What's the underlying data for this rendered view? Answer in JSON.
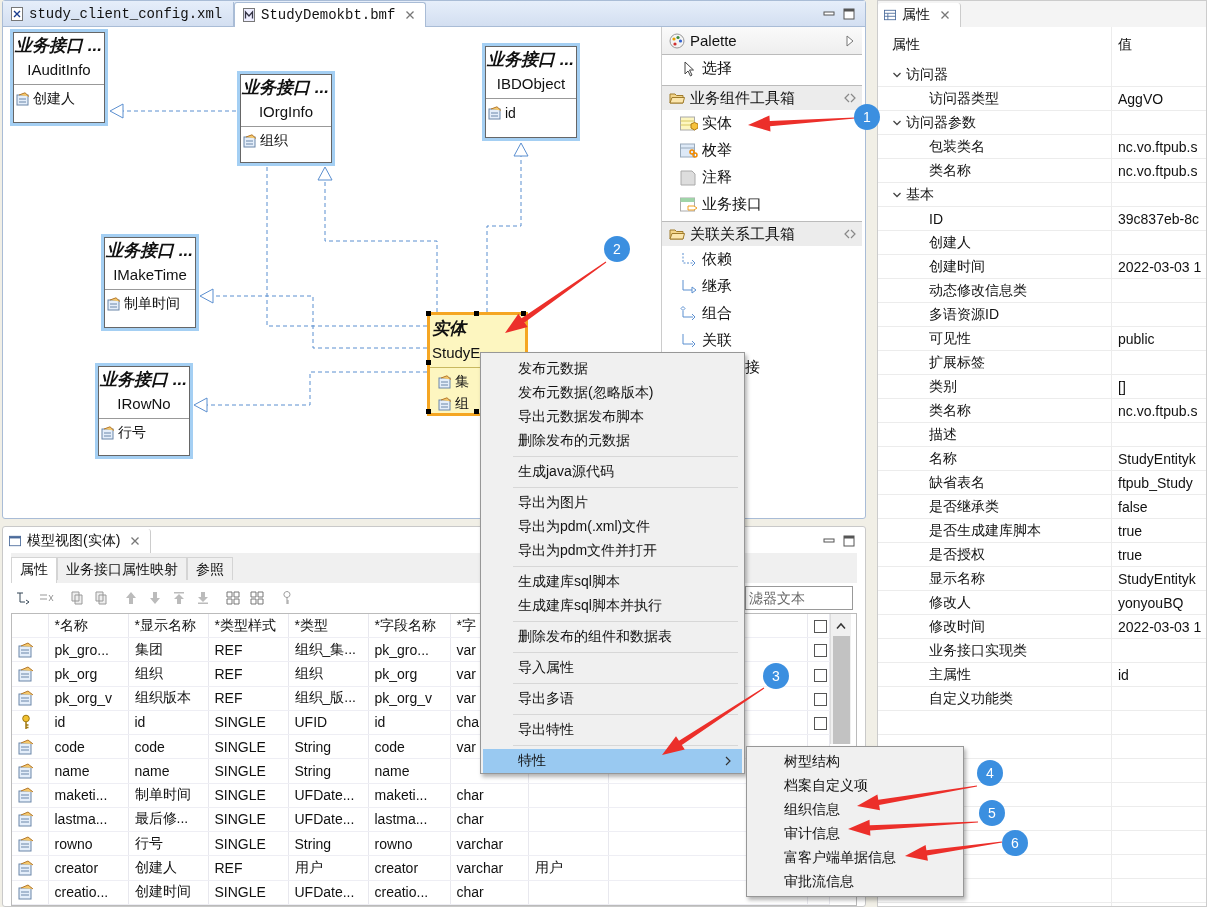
{
  "editor": {
    "tabs": [
      {
        "label": "study_client_config.xml",
        "kind": "xml",
        "selected": false,
        "closable": false
      },
      {
        "label": "StudyDemokbt.bmf",
        "kind": "bmf",
        "selected": true,
        "closable": true
      }
    ],
    "nodes": [
      {
        "kind": "interface",
        "stereotype": "业务接口 ...",
        "name": "IAuditInfo",
        "attributes": [
          "创建人"
        ],
        "selected": false
      },
      {
        "kind": "interface",
        "stereotype": "业务接口 ...",
        "name": "IOrgInfo",
        "attributes": [
          "组织"
        ],
        "selected": false
      },
      {
        "kind": "interface",
        "stereotype": "业务接口 ...",
        "name": "IBDObject",
        "attributes": [
          "id"
        ],
        "selected": false
      },
      {
        "kind": "interface",
        "stereotype": "业务接口 ...",
        "name": "IMakeTime",
        "attributes": [
          "制单时间"
        ],
        "selected": false
      },
      {
        "kind": "interface",
        "stereotype": "业务接口 ...",
        "name": "IRowNo",
        "attributes": [
          "行号"
        ],
        "selected": false
      },
      {
        "kind": "entity",
        "stereotype": "实体",
        "name": "StudyE",
        "attributes": [
          "集",
          "组"
        ],
        "selected": true
      }
    ],
    "connectors": [
      {
        "kind": "realization"
      },
      {
        "kind": "realization"
      },
      {
        "kind": "realization"
      },
      {
        "kind": "realization"
      },
      {
        "kind": "realization"
      }
    ],
    "palette": {
      "title": "Palette",
      "tools": [
        {
          "label": "选择",
          "kind": "select"
        }
      ],
      "drawers": [
        {
          "label": "业务组件工具箱",
          "expanded": true,
          "items": [
            {
              "label": "实体",
              "kind": "entity"
            },
            {
              "label": "枚举",
              "kind": "enum"
            },
            {
              "label": "注释",
              "kind": "note"
            },
            {
              "label": "业务接口",
              "kind": "interface"
            }
          ]
        },
        {
          "label": "关联关系工具箱",
          "expanded": true,
          "items": [
            {
              "label": "依赖",
              "kind": "dependency"
            },
            {
              "label": "继承",
              "kind": "inherit"
            },
            {
              "label": "组合",
              "kind": "compose"
            },
            {
              "label": "关联",
              "kind": "associate"
            },
            {
              "label": "接",
              "kind": "covered"
            }
          ]
        }
      ]
    }
  },
  "model_view": {
    "title": "模型视图(实体)",
    "tabs": [
      {
        "label": "属性",
        "selected": true
      },
      {
        "label": "业务接口属性映射",
        "selected": false
      },
      {
        "label": "参照",
        "selected": false
      }
    ],
    "filter": {
      "placeholder": "滤器文本"
    },
    "all_checked": false,
    "columns": [
      "*名称",
      "*显示名称",
      "*类型样式",
      "*类型",
      "*字段名称",
      "*字"
    ],
    "rows": [
      {
        "kind": "attribute",
        "cells": [
          "pk_gro...",
          "集团",
          "REF",
          "组织_集...",
          "pk_gro...",
          "var"
        ],
        "checked": false
      },
      {
        "kind": "attribute",
        "cells": [
          "pk_org",
          "组织",
          "REF",
          "组织",
          "pk_org",
          "var"
        ],
        "checked": false
      },
      {
        "kind": "attribute",
        "cells": [
          "pk_org_v",
          "组织版本",
          "REF",
          "组织_版...",
          "pk_org_v",
          "var"
        ],
        "checked": false
      },
      {
        "kind": "key",
        "cells": [
          "id",
          "id",
          "SINGLE",
          "UFID",
          "id",
          "cha"
        ],
        "checked": false
      },
      {
        "kind": "attribute",
        "cells": [
          "code",
          "code",
          "SINGLE",
          "String",
          "code",
          "var"
        ]
      },
      {
        "kind": "attribute",
        "cells": [
          "name",
          "name",
          "SINGLE",
          "String",
          "name"
        ]
      },
      {
        "kind": "attribute",
        "cells": [
          "maketi...",
          "制单时间",
          "SINGLE",
          "UFDate...",
          "maketi...",
          "char"
        ]
      },
      {
        "kind": "attribute",
        "cells": [
          "lastma...",
          "最后修...",
          "SINGLE",
          "UFDate...",
          "lastma...",
          "char"
        ]
      },
      {
        "kind": "attribute",
        "cells": [
          "rowno",
          "行号",
          "SINGLE",
          "String",
          "rowno",
          "varchar"
        ]
      },
      {
        "kind": "attribute",
        "cells": [
          "creator",
          "创建人",
          "REF",
          "用户",
          "creator",
          "varchar",
          "用户"
        ]
      },
      {
        "kind": "attribute",
        "cells": [
          "creatio...",
          "创建时间",
          "SINGLE",
          "UFDate...",
          "creatio...",
          "char"
        ]
      }
    ]
  },
  "properties": {
    "title": "属性",
    "columns": [
      "属性",
      "值"
    ],
    "categories": [
      {
        "label": "访问器",
        "expanded": true,
        "children": [
          {
            "name": "访问器类型",
            "value": "AggVO"
          }
        ]
      },
      {
        "label": "访问器参数",
        "expanded": true,
        "children": [
          {
            "name": "包装类名",
            "value": "nc.vo.ftpub.s"
          },
          {
            "name": "类名称",
            "value": "nc.vo.ftpub.s"
          }
        ]
      },
      {
        "label": "基本",
        "expanded": true,
        "children": [
          {
            "name": "ID",
            "value": "39c837eb-8c"
          },
          {
            "name": "创建人"
          },
          {
            "name": "创建时间",
            "value": "2022-03-03 1"
          },
          {
            "name": "动态修改信息类"
          },
          {
            "name": "多语资源ID"
          },
          {
            "name": "可见性",
            "value": "public"
          },
          {
            "name": "扩展标签"
          },
          {
            "name": "类别",
            "value": "[]"
          },
          {
            "name": "类名称",
            "value": "nc.vo.ftpub.s"
          },
          {
            "name": "描述"
          },
          {
            "name": "名称",
            "value": "StudyEntityk"
          },
          {
            "name": "缺省表名",
            "value": "ftpub_Study"
          },
          {
            "name": "是否继承类",
            "value": "false"
          },
          {
            "name": "是否生成建库脚本",
            "value": "true"
          },
          {
            "name": "是否授权",
            "value": "true"
          },
          {
            "name": "显示名称",
            "value": "StudyEntityk"
          },
          {
            "name": "修改人",
            "value": "yonyouBQ"
          },
          {
            "name": "修改时间",
            "value": "2022-03-03 1"
          },
          {
            "name": "业务接口实现类"
          },
          {
            "name": "主属性",
            "value": "id"
          },
          {
            "name": "自定义功能类"
          }
        ]
      }
    ]
  },
  "context_menu": {
    "groups": [
      [
        {
          "label": "发布元数据",
          "selected": false,
          "submenu": false
        },
        {
          "label": "发布元数据(忽略版本)",
          "selected": false,
          "submenu": false
        },
        {
          "label": "导出元数据发布脚本",
          "selected": false,
          "submenu": false
        },
        {
          "label": "删除发布的元数据",
          "selected": false,
          "submenu": false
        }
      ],
      [
        {
          "label": "生成java源代码",
          "selected": false,
          "submenu": false
        }
      ],
      [
        {
          "label": "导出为图片",
          "selected": false,
          "submenu": false
        },
        {
          "label": "导出为pdm(.xml)文件",
          "selected": false,
          "submenu": false
        },
        {
          "label": "导出为pdm文件并打开",
          "selected": false,
          "submenu": false
        }
      ],
      [
        {
          "label": "生成建库sql脚本",
          "selected": false,
          "submenu": false
        },
        {
          "label": "生成建库sql脚本并执行",
          "selected": false,
          "submenu": false
        }
      ],
      [
        {
          "label": "删除发布的组件和数据表",
          "selected": false,
          "submenu": false
        }
      ],
      [
        {
          "label": "导入属性",
          "selected": false,
          "submenu": false
        }
      ],
      [
        {
          "label": "导出多语",
          "selected": false,
          "submenu": false
        }
      ],
      [
        {
          "label": "导出特性",
          "selected": false,
          "submenu": false
        }
      ],
      [
        {
          "label": "特性",
          "selected": true,
          "submenu": true
        }
      ]
    ],
    "submenu": [
      "树型结构",
      "档案自定义项",
      "组织信息",
      "审计信息",
      "富客户端单据信息",
      "审批流信息"
    ]
  },
  "callouts": [
    {
      "label": "1"
    },
    {
      "label": "2"
    },
    {
      "label": "3"
    },
    {
      "label": "4"
    },
    {
      "label": "5"
    },
    {
      "label": "6"
    }
  ]
}
